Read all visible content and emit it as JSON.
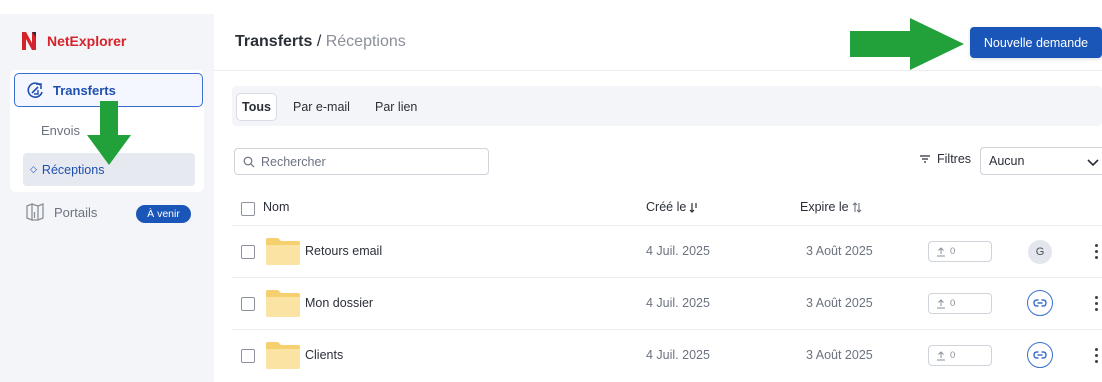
{
  "app": {
    "name": "NetExplorer",
    "brand_color": "#d6222a",
    "accent_color": "#1a56b8"
  },
  "sidebar": {
    "transferts_label": "Transferts",
    "envois_label": "Envois",
    "receptions_label": "Réceptions",
    "portails_label": "Portails",
    "portails_badge": "À venir"
  },
  "header": {
    "breadcrumb_root": "Transferts",
    "breadcrumb_sep": " / ",
    "breadcrumb_current": "Réceptions",
    "new_request_label": "Nouvelle demande"
  },
  "tabs": [
    "Tous",
    "Par e-mail",
    "Par lien"
  ],
  "search": {
    "placeholder": "Rechercher"
  },
  "filters": {
    "label": "Filtres",
    "selected": "Aucun"
  },
  "table": {
    "columns": {
      "name": "Nom",
      "created": "Créé le",
      "expires": "Expire le"
    },
    "rows": [
      {
        "name": "Retours email",
        "created": "4 Juil. 2025",
        "expires": "3 Août 2025",
        "uploads": "0",
        "owner": "G",
        "icon": "avatar"
      },
      {
        "name": "Mon dossier",
        "created": "4 Juil. 2025",
        "expires": "3 Août 2025",
        "uploads": "0",
        "icon": "link-icon"
      },
      {
        "name": "Clients",
        "created": "4 Juil. 2025",
        "expires": "3 Août 2025",
        "uploads": "0",
        "icon": "link-icon"
      }
    ]
  },
  "annotations": {
    "arrow_color": "#22a03a"
  }
}
